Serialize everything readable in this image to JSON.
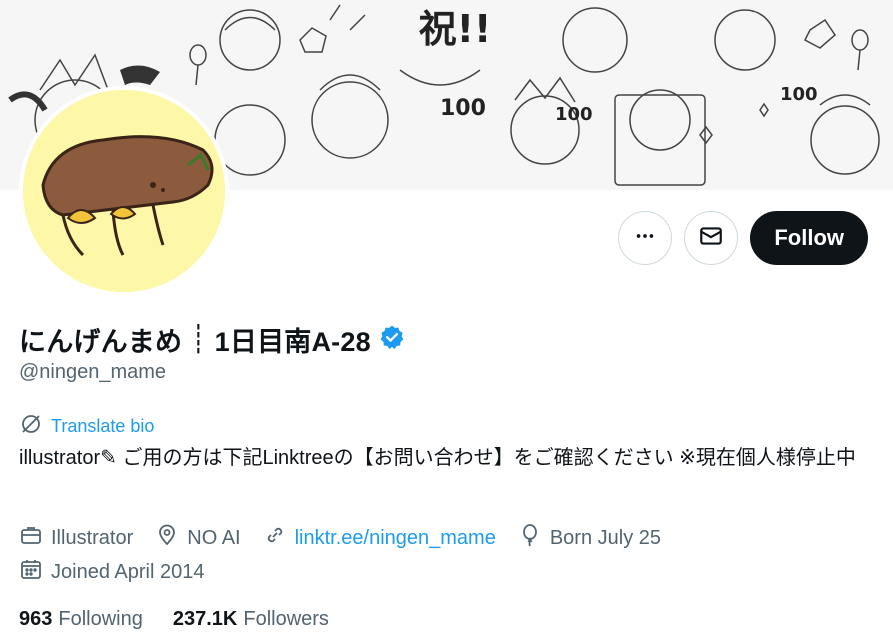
{
  "profile": {
    "name": "にんげんまめ",
    "name_separator": "┊",
    "name_suffix": "1日目南A-28",
    "handle": "@ningen_mame",
    "bio": "illustrator✎ ご用の方は下記Linktreeの【お問い合わせ】をご確認ください ※現在個人様停止中"
  },
  "actions": {
    "more_icon": "more-horizontal-icon",
    "message_icon": "mail-icon",
    "follow_label": "Follow"
  },
  "translate": {
    "label": "Translate bio",
    "icon": "translate-icon"
  },
  "meta": {
    "profession": "Illustrator",
    "location": "NO AI",
    "link": "linktr.ee/ningen_mame",
    "birthday": "Born July 25",
    "joined": "Joined April 2014"
  },
  "stats": {
    "following_count": "963",
    "following_label": "Following",
    "followers_count": "237.1K",
    "followers_label": "Followers"
  },
  "banner": {
    "celebration_text": "祝!!",
    "milestone_text": "100"
  },
  "colors": {
    "accent": "#1d9bf0",
    "verified": "#1d9bf0",
    "follow_bg": "#0f1419",
    "avatar_bg": "#fdf7a8",
    "secondary_text": "#536471"
  }
}
